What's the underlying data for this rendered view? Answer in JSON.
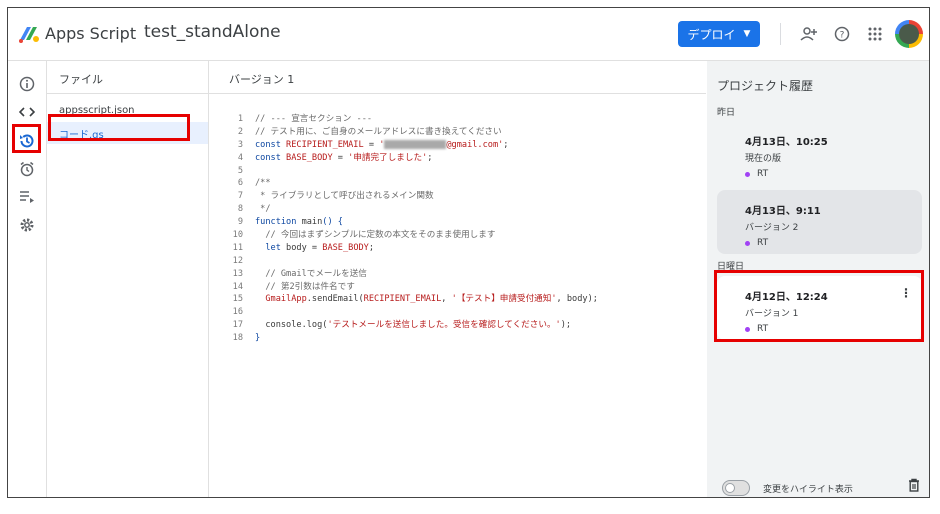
{
  "header": {
    "brand": "Apps Script",
    "project_name": "test_standAlone",
    "deploy_label": "デプロイ",
    "icons": [
      "add-person-icon",
      "help-icon",
      "apps-grid-icon"
    ]
  },
  "rail": {
    "icons": [
      "info-icon",
      "code-icon",
      "history-icon",
      "alarm-icon",
      "executions-icon",
      "settings-icon"
    ]
  },
  "files": {
    "title": "ファイル",
    "items": [
      {
        "name": "appsscript.json"
      },
      {
        "name": "コード.gs"
      }
    ]
  },
  "editor": {
    "title": "バージョン 1",
    "lines": [
      {
        "n": "1",
        "parts": [
          {
            "t": "// --- 宣言セクション ---",
            "c": "com"
          }
        ]
      },
      {
        "n": "2",
        "parts": [
          {
            "t": "// テスト用に、ご自身のメールアドレスに書き換えてください",
            "c": "com"
          }
        ]
      },
      {
        "n": "3",
        "parts": [
          {
            "t": "const ",
            "c": "kw"
          },
          {
            "t": "RECIPIENT_EMAIL",
            "c": "str"
          },
          {
            "t": " = ",
            "c": ""
          },
          {
            "t": "'",
            "c": "str"
          },
          {
            "t": "",
            "c": "blur"
          },
          {
            "t": "@gmail.com'",
            "c": "str"
          },
          {
            "t": ";",
            "c": ""
          }
        ]
      },
      {
        "n": "4",
        "parts": [
          {
            "t": "const ",
            "c": "kw"
          },
          {
            "t": "BASE_BODY",
            "c": "str"
          },
          {
            "t": " = ",
            "c": ""
          },
          {
            "t": "'申請完了しました'",
            "c": "str"
          },
          {
            "t": ";",
            "c": ""
          }
        ]
      },
      {
        "n": "5",
        "parts": []
      },
      {
        "n": "6",
        "parts": [
          {
            "t": "/**",
            "c": "com"
          }
        ]
      },
      {
        "n": "7",
        "parts": [
          {
            "t": " * ライブラリとして呼び出されるメイン関数",
            "c": "com"
          }
        ]
      },
      {
        "n": "8",
        "parts": [
          {
            "t": " */",
            "c": "com"
          }
        ]
      },
      {
        "n": "9",
        "parts": [
          {
            "t": "function ",
            "c": "kw"
          },
          {
            "t": "main",
            "c": ""
          },
          {
            "t": "() {",
            "c": "kw"
          }
        ]
      },
      {
        "n": "10",
        "parts": [
          {
            "t": "  // 今回はまずシンプルに定数の本文をそのまま使用します",
            "c": "com"
          }
        ]
      },
      {
        "n": "11",
        "parts": [
          {
            "t": "  let ",
            "c": "kw"
          },
          {
            "t": "body",
            "c": ""
          },
          {
            "t": " = ",
            "c": ""
          },
          {
            "t": "BASE_BODY",
            "c": "str"
          },
          {
            "t": ";",
            "c": ""
          }
        ]
      },
      {
        "n": "12",
        "parts": []
      },
      {
        "n": "13",
        "parts": [
          {
            "t": "  // Gmailでメールを送信",
            "c": "com"
          }
        ]
      },
      {
        "n": "14",
        "parts": [
          {
            "t": "  // 第2引数は件名です",
            "c": "com"
          }
        ]
      },
      {
        "n": "15",
        "parts": [
          {
            "t": "  GmailApp",
            "c": "str"
          },
          {
            "t": ".sendEmail(",
            "c": ""
          },
          {
            "t": "RECIPIENT_EMAIL",
            "c": "str"
          },
          {
            "t": ", ",
            "c": ""
          },
          {
            "t": "'【テスト】申請受付通知'",
            "c": "str"
          },
          {
            "t": ", body);",
            "c": ""
          }
        ]
      },
      {
        "n": "16",
        "parts": []
      },
      {
        "n": "17",
        "parts": [
          {
            "t": "  console",
            "c": ""
          },
          {
            "t": ".log(",
            "c": ""
          },
          {
            "t": "'テストメールを送信しました。受信を確認してください。'",
            "c": "str"
          },
          {
            "t": ");",
            "c": ""
          }
        ]
      },
      {
        "n": "18",
        "parts": [
          {
            "t": "}",
            "c": "kw"
          }
        ]
      }
    ]
  },
  "history": {
    "title": "プロジェクト履歴",
    "groups": [
      {
        "label": "昨日",
        "cards": [
          {
            "time": "4月13日、10:25",
            "version": "現在の版",
            "user": "RT"
          },
          {
            "time": "4月13日、9:11",
            "version": "バージョン 2",
            "user": "RT"
          }
        ]
      },
      {
        "label": "日曜日",
        "cards": [
          {
            "time": "4月12日、12:24",
            "version": "バージョン 1",
            "user": "RT"
          }
        ]
      }
    ],
    "toggle_label": "変更をハイライト表示",
    "highlight_changes": false
  },
  "colors": {
    "accent": "#1a73e8",
    "annotation_red": "#e60000",
    "user_dot": "#a142f4"
  }
}
